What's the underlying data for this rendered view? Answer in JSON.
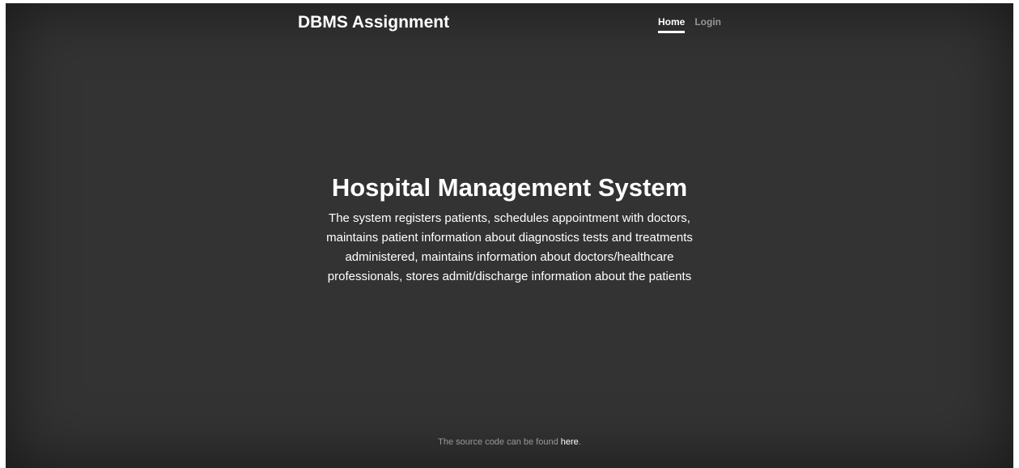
{
  "header": {
    "brand": "DBMS Assignment",
    "nav": {
      "home": "Home",
      "login": "Login"
    }
  },
  "main": {
    "title": "Hospital Management System",
    "description": "The system registers patients, schedules appointment with doctors, maintains patient information about diagnostics tests and treatments administered, maintains information about doctors/healthcare professionals, stores admit/discharge information about the patients"
  },
  "footer": {
    "text_before": "The source code can be found ",
    "link_label": "here",
    "text_after": "."
  },
  "colors": {
    "background": "#333333",
    "text": "#ffffff",
    "muted_text": "#999999"
  }
}
